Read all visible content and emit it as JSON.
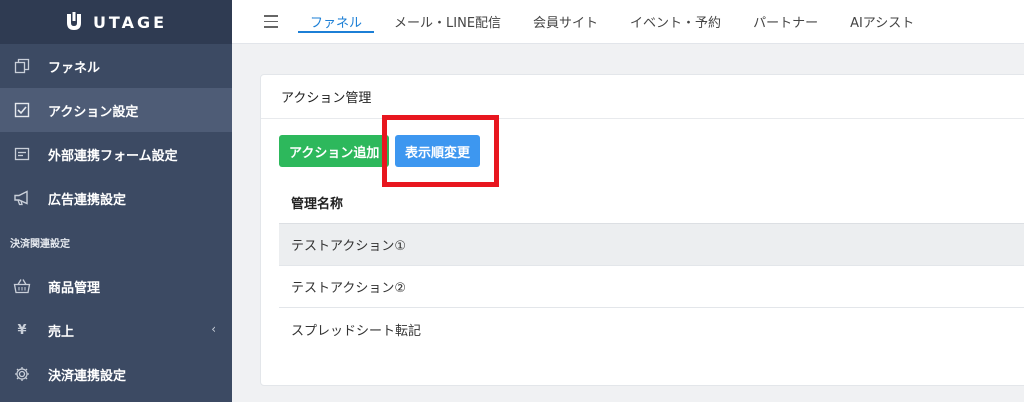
{
  "app": {
    "logo_text": "UTAGE"
  },
  "sidebar": {
    "items": [
      {
        "label": "ファネル",
        "icon": "copy-icon"
      },
      {
        "label": "アクション設定",
        "icon": "checkbox-icon",
        "active": true
      },
      {
        "label": "外部連携フォーム設定",
        "icon": "form-icon"
      },
      {
        "label": "広告連携設定",
        "icon": "megaphone-icon"
      }
    ],
    "section_title": "決済関連設定",
    "section_items": [
      {
        "label": "商品管理",
        "icon": "basket-icon"
      },
      {
        "label": "売上",
        "icon": "yen-icon",
        "chevron": "‹"
      },
      {
        "label": "決済連携設定",
        "icon": "gear-icon"
      }
    ]
  },
  "topnav": {
    "tabs": [
      {
        "label": "ファネル",
        "active": true
      },
      {
        "label": "メール・LINE配信"
      },
      {
        "label": "会員サイト"
      },
      {
        "label": "イベント・予約"
      },
      {
        "label": "パートナー"
      },
      {
        "label": "AIアシスト"
      }
    ]
  },
  "main": {
    "card_title": "アクション管理",
    "add_button": "アクション追加",
    "reorder_button": "表示順変更",
    "table": {
      "header": "管理名称",
      "rows": [
        "テストアクション①",
        "テストアクション②",
        "スプレッドシート転記"
      ]
    }
  },
  "colors": {
    "accent": "#1c7fd6",
    "sidebar": "#3c4a63",
    "add_button": "#2db85c",
    "reorder_button": "#3d97f0",
    "highlight": "#e8161f"
  }
}
